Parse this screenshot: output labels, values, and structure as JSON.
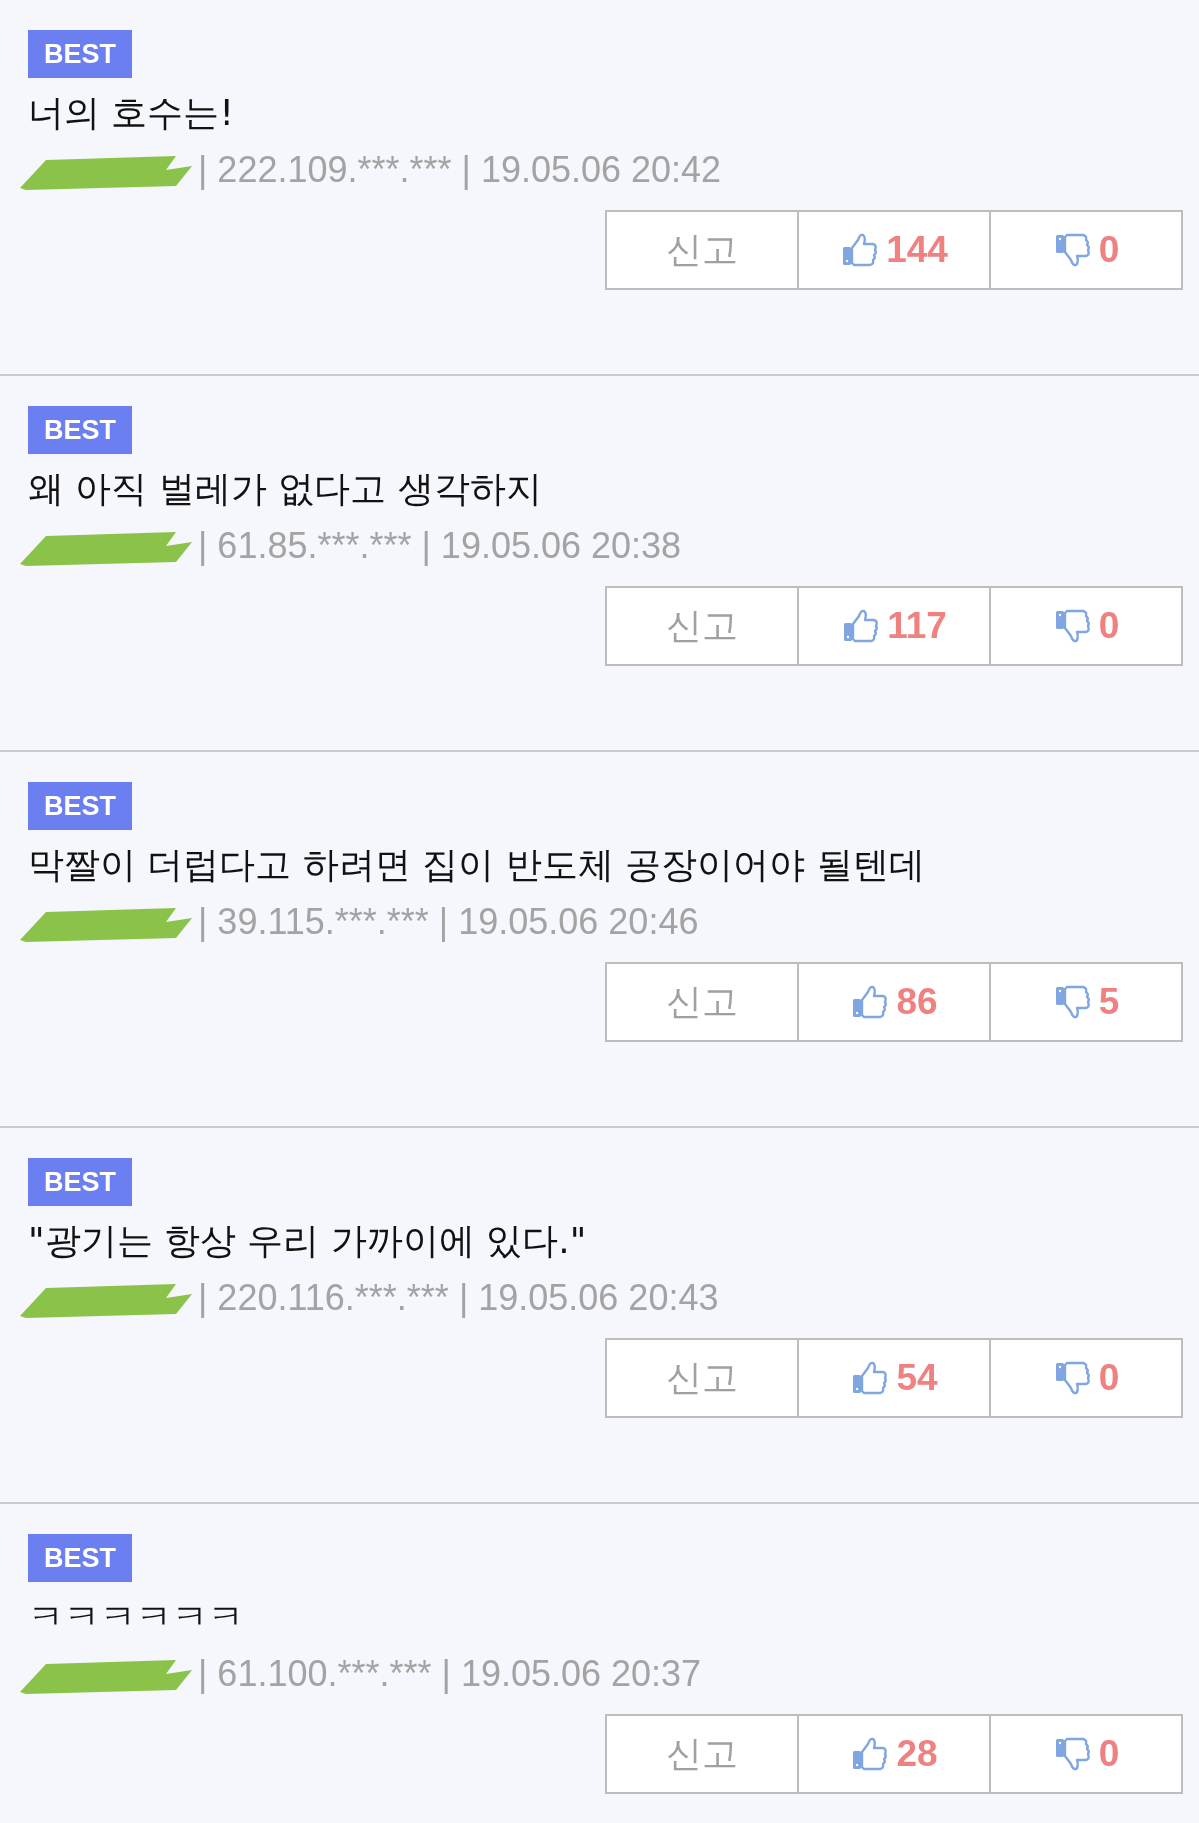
{
  "comments": [
    {
      "badge": "BEST",
      "text": "너의 호수는!",
      "name_redacted": true,
      "meta": "| 222.109.***.*** | 19.05.06 20:42",
      "report": "신고",
      "likes": "144",
      "dislikes": "0"
    },
    {
      "badge": "BEST",
      "text": "왜 아직 벌레가 없다고 생각하지",
      "name_redacted": true,
      "meta": "| 61.85.***.*** | 19.05.06 20:38",
      "report": "신고",
      "likes": "117",
      "dislikes": "0"
    },
    {
      "badge": "BEST",
      "text": "막짤이 더럽다고 하려면 집이 반도체 공장이어야 될텐데",
      "name_redacted": true,
      "meta": "| 39.115.***.*** | 19.05.06 20:46",
      "report": "신고",
      "likes": "86",
      "dislikes": "5"
    },
    {
      "badge": "BEST",
      "text": "\"광기는 항상 우리 가까이에 있다.\"",
      "name_redacted": true,
      "meta": "| 220.116.***.*** | 19.05.06 20:43",
      "report": "신고",
      "likes": "54",
      "dislikes": "0"
    },
    {
      "badge": "BEST",
      "text": "ㅋㅋㅋㅋㅋㅋ",
      "name_redacted": true,
      "meta": "| 61.100.***.*** | 19.05.06 20:37",
      "report": "신고",
      "likes": "28",
      "dislikes": "0"
    }
  ]
}
